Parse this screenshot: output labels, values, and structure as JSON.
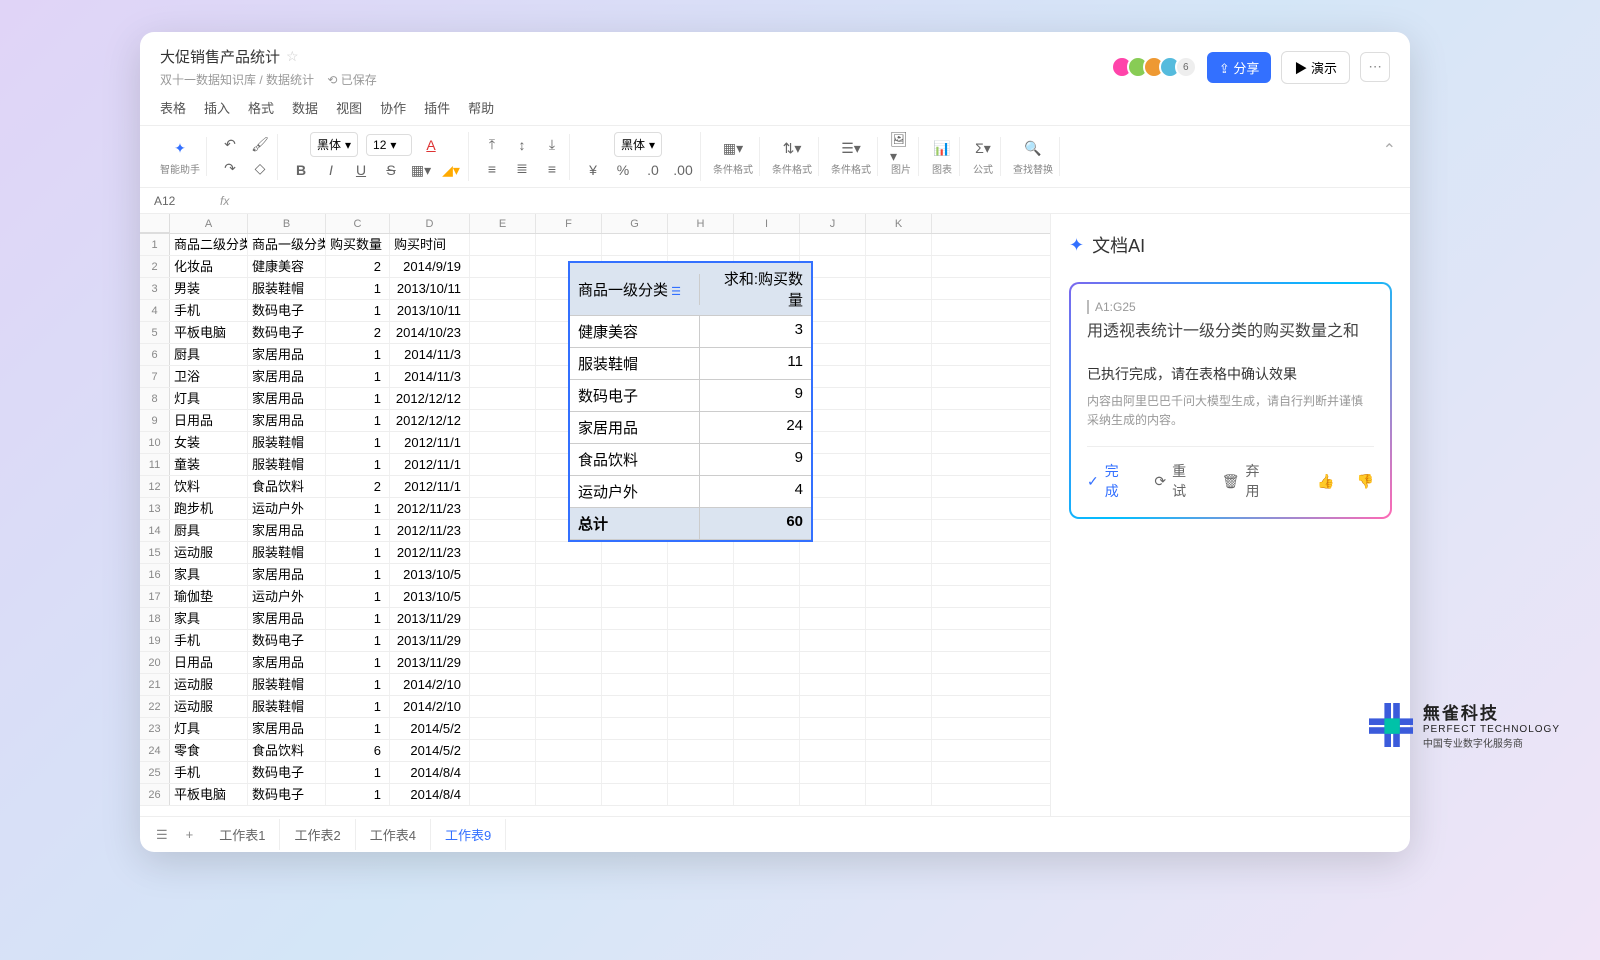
{
  "header": {
    "title": "大促销售产品统计",
    "breadcrumb": "双十一数据知识库 / 数据统计",
    "saved": "已保存",
    "avatar_count": "6",
    "share": "分享",
    "present": "演示"
  },
  "menu": [
    "表格",
    "插入",
    "格式",
    "数据",
    "视图",
    "协作",
    "插件",
    "帮助"
  ],
  "toolbar": {
    "ai": "智能助手",
    "font": "黑体",
    "size": "12",
    "font2": "黑体",
    "g_cond": "条件格式",
    "g_cond2": "条件格式",
    "g_cond3": "条件格式",
    "g_img": "图片",
    "g_chart": "图表",
    "g_formula": "公式",
    "g_find": "查找替换"
  },
  "formula": {
    "cell": "A12",
    "fx": "fx"
  },
  "columns": [
    "A",
    "B",
    "C",
    "D",
    "E",
    "F",
    "G",
    "H",
    "I",
    "J",
    "K"
  ],
  "headers": [
    "商品二级分类",
    "商品一级分类",
    "购买数量",
    "购买时间"
  ],
  "rows": [
    [
      "化妆品",
      "健康美容",
      "2",
      "2014/9/19"
    ],
    [
      "男装",
      "服装鞋帽",
      "1",
      "2013/10/11"
    ],
    [
      "手机",
      "数码电子",
      "1",
      "2013/10/11"
    ],
    [
      "平板电脑",
      "数码电子",
      "2",
      "2014/10/23"
    ],
    [
      "厨具",
      "家居用品",
      "1",
      "2014/11/3"
    ],
    [
      "卫浴",
      "家居用品",
      "1",
      "2014/11/3"
    ],
    [
      "灯具",
      "家居用品",
      "1",
      "2012/12/12"
    ],
    [
      "日用品",
      "家居用品",
      "1",
      "2012/12/12"
    ],
    [
      "女装",
      "服装鞋帽",
      "1",
      "2012/11/1"
    ],
    [
      "童装",
      "服装鞋帽",
      "1",
      "2012/11/1"
    ],
    [
      "饮料",
      "食品饮料",
      "2",
      "2012/11/1"
    ],
    [
      "跑步机",
      "运动户外",
      "1",
      "2012/11/23"
    ],
    [
      "厨具",
      "家居用品",
      "1",
      "2012/11/23"
    ],
    [
      "运动服",
      "服装鞋帽",
      "1",
      "2012/11/23"
    ],
    [
      "家具",
      "家居用品",
      "1",
      "2013/10/5"
    ],
    [
      "瑜伽垫",
      "运动户外",
      "1",
      "2013/10/5"
    ],
    [
      "家具",
      "家居用品",
      "1",
      "2013/11/29"
    ],
    [
      "手机",
      "数码电子",
      "1",
      "2013/11/29"
    ],
    [
      "日用品",
      "家居用品",
      "1",
      "2013/11/29"
    ],
    [
      "运动服",
      "服装鞋帽",
      "1",
      "2014/2/10"
    ],
    [
      "运动服",
      "服装鞋帽",
      "1",
      "2014/2/10"
    ],
    [
      "灯具",
      "家居用品",
      "1",
      "2014/5/2"
    ],
    [
      "零食",
      "食品饮料",
      "6",
      "2014/5/2"
    ],
    [
      "手机",
      "数码电子",
      "1",
      "2014/8/4"
    ],
    [
      "平板电脑",
      "数码电子",
      "1",
      "2014/8/4"
    ]
  ],
  "pivot": {
    "h1": "商品一级分类",
    "h2": "求和:购买数量",
    "rows": [
      [
        "健康美容",
        "3"
      ],
      [
        "服装鞋帽",
        "11"
      ],
      [
        "数码电子",
        "9"
      ],
      [
        "家居用品",
        "24"
      ],
      [
        "食品饮料",
        "9"
      ],
      [
        "运动户外",
        "4"
      ]
    ],
    "total_label": "总计",
    "total": "60"
  },
  "ai": {
    "title": "文档AI",
    "range": "A1:G25",
    "question": "用透视表统计一级分类的购买数量之和",
    "status": "已执行完成，请在表格中确认效果",
    "note": "内容由阿里巴巴千问大模型生成，请自行判断并谨慎采纳生成的内容。",
    "done": "完成",
    "retry": "重试",
    "discard": "弃用"
  },
  "tabs": [
    "工作表1",
    "工作表2",
    "工作表4",
    "工作表9"
  ],
  "active_tab": 3,
  "vendor": {
    "l1": "無雀科技",
    "l2": "PERFECT TECHNOLOGY",
    "l3": "中国专业数字化服务商"
  }
}
